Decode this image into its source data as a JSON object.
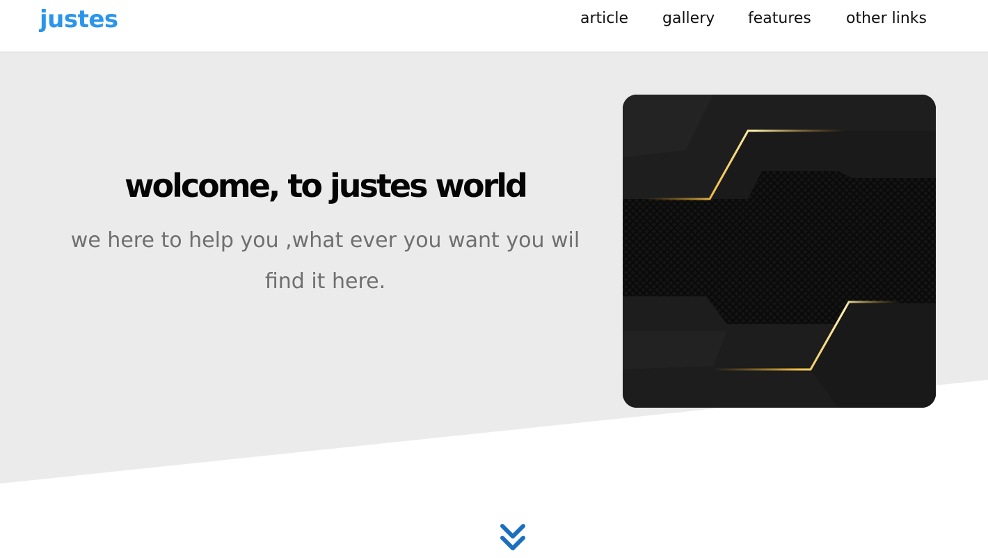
{
  "header": {
    "logo": "justes",
    "nav": [
      {
        "label": "article"
      },
      {
        "label": "gallery"
      },
      {
        "label": "features"
      },
      {
        "label": "other links"
      }
    ]
  },
  "hero": {
    "title": "wolcome, to justes world",
    "subtitle": "we here to help you ,what ever you want you wil find it here.",
    "image_icon": "dark-gold-abstract-image"
  },
  "scroll": {
    "icon": "double-chevron-down-icon"
  },
  "colors": {
    "brand": "#2b95ec",
    "hero_bg": "#ebebeb",
    "chevron": "#1a6fc0"
  }
}
